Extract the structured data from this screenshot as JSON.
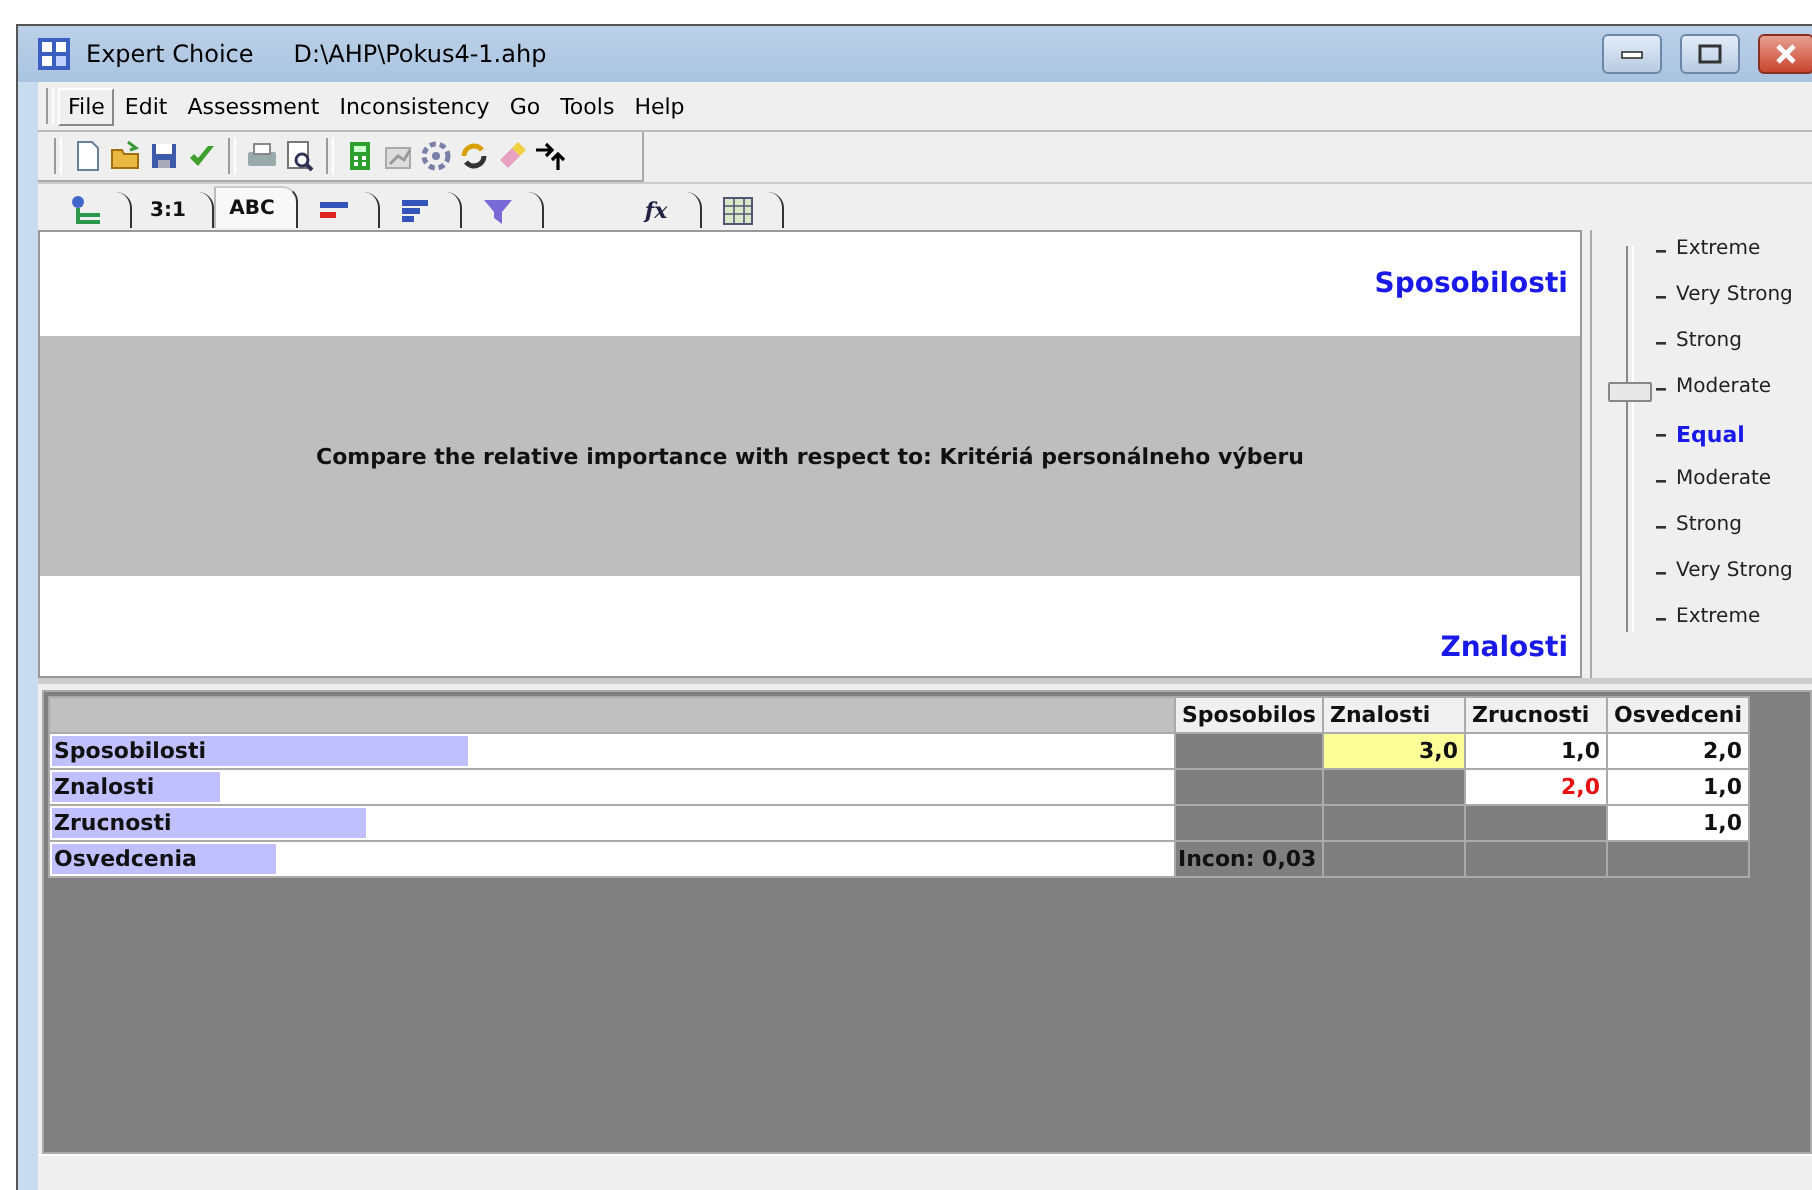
{
  "window": {
    "title": "Expert Choice",
    "file_path": "D:\\AHP\\Pokus4-1.ahp"
  },
  "menu": [
    {
      "label": "File",
      "selected": true
    },
    {
      "label": "Edit",
      "selected": false
    },
    {
      "label": "Assessment",
      "selected": false
    },
    {
      "label": "Inconsistency",
      "selected": false
    },
    {
      "label": "Go",
      "selected": false
    },
    {
      "label": "Tools",
      "selected": false
    },
    {
      "label": "Help",
      "selected": false
    }
  ],
  "tabs": [
    {
      "selected": false
    },
    {
      "label": "3:1",
      "selected": false
    },
    {
      "label": "ABC",
      "selected": true
    },
    {
      "selected": false
    },
    {
      "selected": false
    },
    {
      "selected": false
    },
    {
      "label": "fx",
      "selected": false
    },
    {
      "selected": false
    }
  ],
  "comparison": {
    "left": "Sposobilosti",
    "prompt": "Compare the relative importance with respect to: Kritériá personálneho výberu",
    "right": "Znalosti"
  },
  "scale": {
    "labels": [
      {
        "label": "Extreme",
        "selected": false
      },
      {
        "label": "Very Strong",
        "selected": false
      },
      {
        "label": "Strong",
        "selected": false
      },
      {
        "label": "Moderate",
        "selected": false
      },
      {
        "label": "Equal",
        "selected": true
      },
      {
        "label": "Moderate",
        "selected": false
      },
      {
        "label": "Strong",
        "selected": false
      },
      {
        "label": "Very Strong",
        "selected": false
      },
      {
        "label": "Extreme",
        "selected": false
      }
    ],
    "level": 0.625
  },
  "matrix": {
    "columns": [
      "Sposobilos",
      "Znalosti",
      "Zrucnosti",
      "Osvedceni"
    ],
    "rows": [
      {
        "name": "Sposobilosti",
        "level": 0.37,
        "cells": [
          {
            "kind": "empty"
          },
          {
            "kind": "value",
            "text": "3,0",
            "selected": true,
            "inverted": false
          },
          {
            "kind": "value",
            "text": "1,0",
            "selected": false,
            "inverted": false
          },
          {
            "kind": "value",
            "text": "2,0",
            "selected": false,
            "inverted": false
          }
        ]
      },
      {
        "name": "Znalosti",
        "level": 0.15,
        "cells": [
          {
            "kind": "empty"
          },
          {
            "kind": "empty"
          },
          {
            "kind": "value",
            "text": "2,0",
            "selected": false,
            "inverted": true
          },
          {
            "kind": "value",
            "text": "1,0",
            "selected": false,
            "inverted": false
          }
        ]
      },
      {
        "name": "Zrucnosti",
        "level": 0.28,
        "cells": [
          {
            "kind": "empty"
          },
          {
            "kind": "empty"
          },
          {
            "kind": "empty"
          },
          {
            "kind": "value",
            "text": "1,0",
            "selected": false,
            "inverted": false
          }
        ]
      },
      {
        "name": "Osvedcenia",
        "level": 0.2,
        "cells": [
          {
            "kind": "note",
            "text": "Incon: 0,03"
          },
          {
            "kind": "empty"
          },
          {
            "kind": "empty"
          },
          {
            "kind": "empty"
          }
        ]
      }
    ]
  }
}
